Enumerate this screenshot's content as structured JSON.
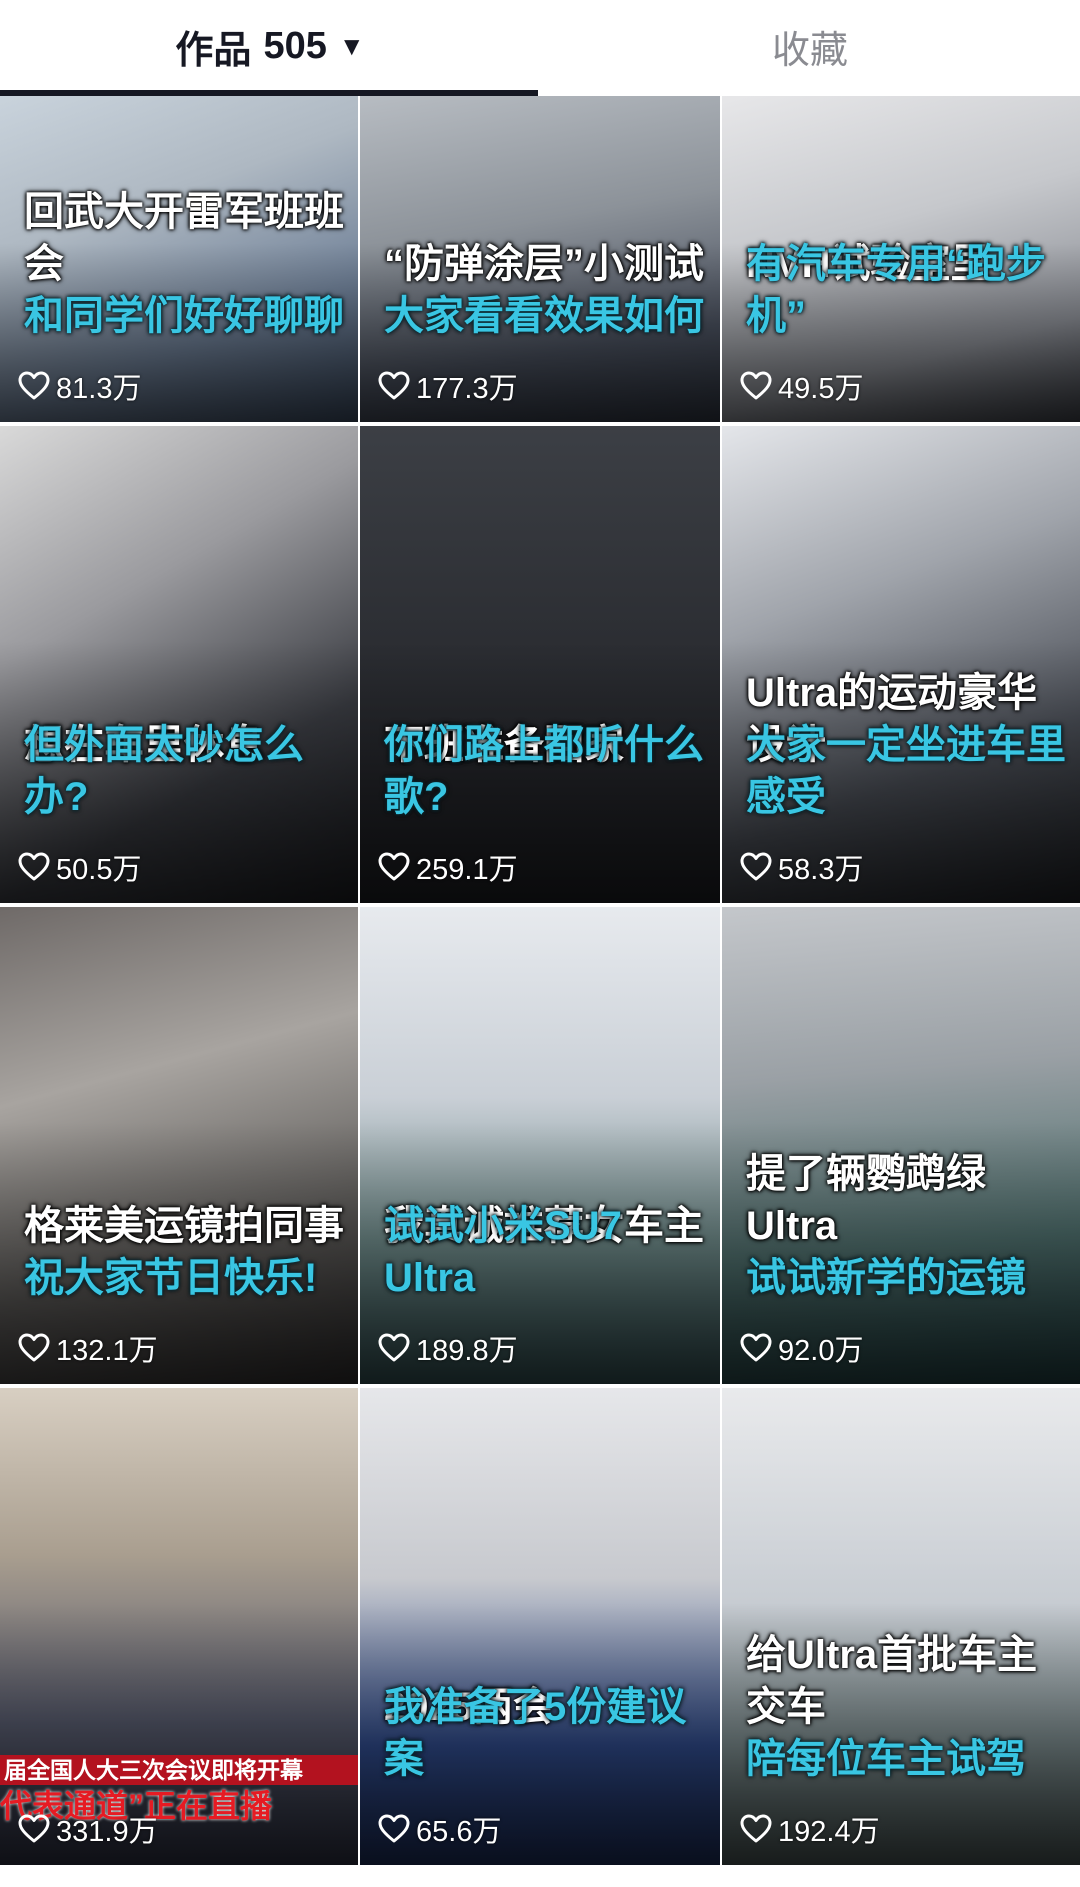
{
  "tabs": {
    "works_label": "作品",
    "works_count": "505",
    "favorites_label": "收藏"
  },
  "colors": {
    "caption_primary": "#ffffff",
    "caption_accent": "#39c6e3",
    "active_tab": "#161823",
    "inactive_tab": "#8a8b91"
  },
  "icons": {
    "dropdown": "caret-down-icon",
    "like": "heart-outline-icon"
  },
  "videos": [
    {
      "line1": "回武大开雷军班班会",
      "line2": "和同学们好好聊聊",
      "likes": "81.3万"
    },
    {
      "line1": "“防弹涂层”小测试",
      "line2": "大家看看效果如何",
      "likes": "177.3万"
    },
    {
      "line1": "NVH试验室里",
      "line2": "有汽车专用“跑步机”",
      "likes": "49.5万"
    },
    {
      "line1": "想在车里休息",
      "line2": "但外面太吵怎么办?",
      "likes": "50.5万"
    },
    {
      "line1": "下班准备回家",
      "line2": "你们路上都听什么歌?",
      "likes": "259.1万"
    },
    {
      "line1": "Ultra的运动豪华设计",
      "line2": "大家一定坐进车里感受",
      "likes": "58.3万"
    },
    {
      "line1": "格莱美运镜拍同事",
      "line2": "祝大家节日快乐!",
      "likes": "132.1万"
    },
    {
      "line1": "我真诚推荐女车主",
      "line2": "试试小米SU7 Ultra",
      "likes": "189.8万"
    },
    {
      "line1": "提了辆鹦鹉绿 Ultra",
      "line2": "试试新学的运镜",
      "likes": "92.0万"
    },
    {
      "line1": "",
      "line2": "",
      "likes": "331.9万",
      "overlay1": "届全国人大三次会议即将开幕",
      "overlay2": "代表通道”正在直播"
    },
    {
      "line1": "2025两会",
      "line2": "我准备了5份建议案",
      "likes": "65.6万"
    },
    {
      "line1": "给Ultra首批车主交车",
      "line2": "陪每位车主试驾",
      "likes": "192.4万"
    }
  ]
}
